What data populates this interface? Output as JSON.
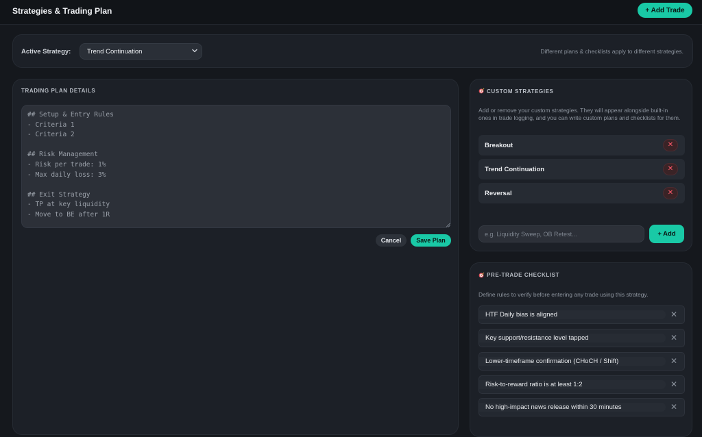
{
  "header": {
    "title": "Strategies & Trading Plan",
    "add_trade_label": "+ Add Trade"
  },
  "strategy_bar": {
    "label": "Active Strategy:",
    "selected": "Trend Continuation",
    "hint": "Different plans & checklists apply to different strategies."
  },
  "plan": {
    "section_title": "TRADING PLAN DETAILS",
    "text": "## Setup & Entry Rules\n- Criteria 1\n- Criteria 2\n\n## Risk Management\n- Risk per trade: 1%\n- Max daily loss: 3%\n\n## Exit Strategy\n- TP at key liquidity\n- Move to BE after 1R",
    "cancel_label": "Cancel",
    "save_label": "Save Plan"
  },
  "custom_strategies": {
    "section_title": "CUSTOM STRATEGIES",
    "description": "Add or remove your custom strategies. They will appear alongside built-in ones in trade logging, and you can write custom plans and checklists for them.",
    "items": [
      {
        "name": "Breakout"
      },
      {
        "name": "Trend Continuation"
      },
      {
        "name": "Reversal"
      }
    ],
    "delete_glyph": "✕",
    "input_placeholder": "e.g. Liquidity Sweep, OB Retest...",
    "add_label": "+ Add"
  },
  "checklist": {
    "section_title": "PRE-TRADE CHECKLIST",
    "description": "Define rules to verify before entering any trade using this strategy.",
    "remove_glyph": "✕",
    "items": [
      {
        "text": "HTF Daily bias is aligned"
      },
      {
        "text": "Key support/resistance level tapped"
      },
      {
        "text": "Lower-timeframe confirmation (CHoCH / Shift)"
      },
      {
        "text": "Risk-to-reward ratio is at least 1:2"
      },
      {
        "text": "No high-impact news release within 30 minutes"
      }
    ]
  },
  "colors": {
    "accent": "#19c9a6",
    "danger": "#ff5a6b",
    "background": "#15181d",
    "card": "#1c2027"
  }
}
